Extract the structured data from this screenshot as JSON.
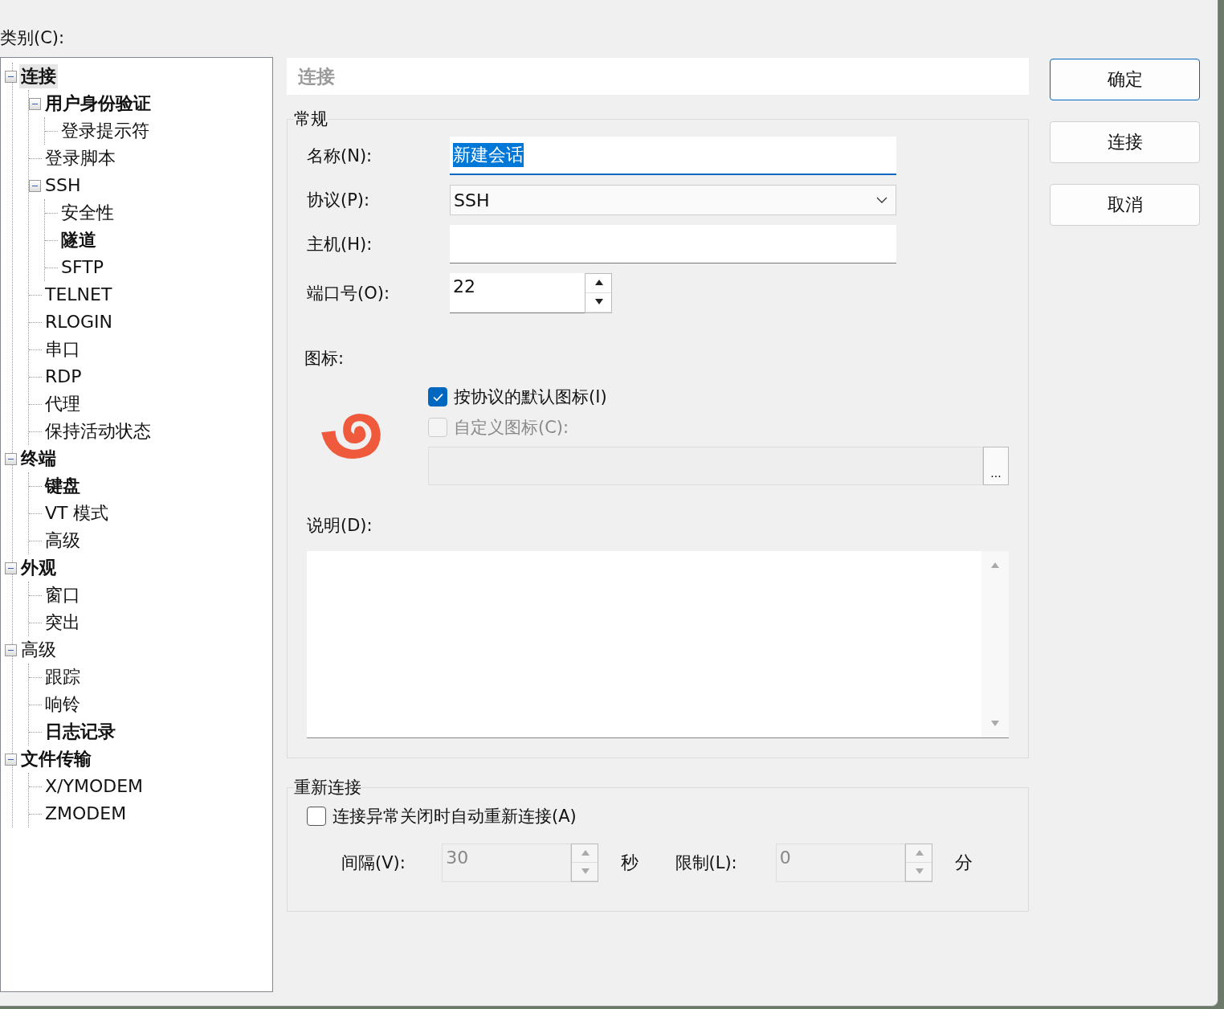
{
  "category_label": "类别(C):",
  "tree": [
    {
      "label": "连接",
      "bold": true,
      "selected": true,
      "expanded": true,
      "children": [
        {
          "label": "用户身份验证",
          "bold": true,
          "selected": false,
          "expanded": true,
          "children": [
            {
              "label": "登录提示符",
              "bold": false,
              "selected": false
            }
          ]
        },
        {
          "label": "登录脚本",
          "bold": false,
          "selected": false
        },
        {
          "label": "SSH",
          "bold": false,
          "selected": false,
          "expanded": true,
          "children": [
            {
              "label": "安全性",
              "bold": false,
              "selected": false
            },
            {
              "label": "隧道",
              "bold": true,
              "selected": false
            },
            {
              "label": "SFTP",
              "bold": false,
              "selected": false
            }
          ]
        },
        {
          "label": "TELNET",
          "bold": false,
          "selected": false
        },
        {
          "label": "RLOGIN",
          "bold": false,
          "selected": false
        },
        {
          "label": "串口",
          "bold": false,
          "selected": false
        },
        {
          "label": "RDP",
          "bold": false,
          "selected": false
        },
        {
          "label": "代理",
          "bold": false,
          "selected": false
        },
        {
          "label": "保持活动状态",
          "bold": false,
          "selected": false
        }
      ]
    },
    {
      "label": "终端",
      "bold": true,
      "selected": false,
      "expanded": true,
      "children": [
        {
          "label": "键盘",
          "bold": true,
          "selected": false
        },
        {
          "label": "VT 模式",
          "bold": false,
          "selected": false
        },
        {
          "label": "高级",
          "bold": false,
          "selected": false
        }
      ]
    },
    {
      "label": "外观",
      "bold": true,
      "selected": false,
      "expanded": true,
      "children": [
        {
          "label": "窗口",
          "bold": false,
          "selected": false
        },
        {
          "label": "突出",
          "bold": false,
          "selected": false
        }
      ]
    },
    {
      "label": "高级",
      "bold": false,
      "selected": false,
      "expanded": true,
      "children": [
        {
          "label": "跟踪",
          "bold": false,
          "selected": false
        },
        {
          "label": "响铃",
          "bold": false,
          "selected": false
        },
        {
          "label": "日志记录",
          "bold": true,
          "selected": false
        }
      ]
    },
    {
      "label": "文件传输",
      "bold": true,
      "selected": false,
      "expanded": true,
      "children": [
        {
          "label": "X/YMODEM",
          "bold": false,
          "selected": false
        },
        {
          "label": "ZMODEM",
          "bold": false,
          "selected": false
        }
      ]
    }
  ],
  "header": "连接",
  "general": {
    "title": "常规",
    "name": {
      "label": "名称(N):",
      "value": "新建会话",
      "text_selected": true
    },
    "protocol": {
      "label": "协议(P):",
      "value": "SSH"
    },
    "host": {
      "label": "主机(H):"
    },
    "port": {
      "label": "端口号(O):",
      "value": "22"
    },
    "icon_label": "图标:",
    "default_icon": {
      "label": "按协议的默认图标(I)",
      "checked": true,
      "disabled": false
    },
    "custom_icon": {
      "label": "自定义图标(C):",
      "checked": false,
      "disabled": true
    },
    "browse": "...",
    "description_label": "说明(D):"
  },
  "reconnect": {
    "title": "重新连接",
    "auto": {
      "label": "连接异常关闭时自动重新连接(A)",
      "checked": false,
      "disabled": false
    },
    "interval": {
      "label": "间隔(V):",
      "value": "30",
      "unit": "秒",
      "disabled": true
    },
    "limit": {
      "label": "限制(L):",
      "value": "0",
      "unit": "分",
      "disabled": true
    }
  },
  "buttons": [
    {
      "label": "确定",
      "default": true
    },
    {
      "label": "连接",
      "default": false
    },
    {
      "label": "取消",
      "default": false
    }
  ]
}
